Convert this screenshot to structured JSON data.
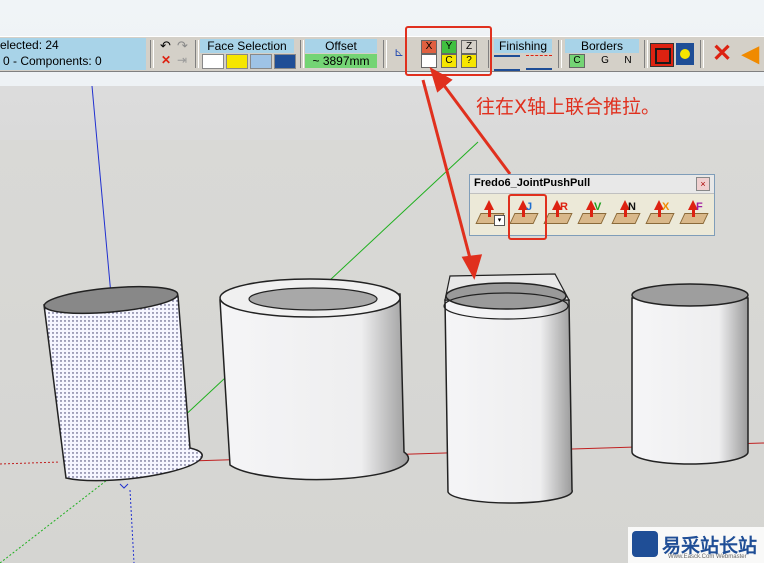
{
  "toolbar": {
    "selected": "elected: 24",
    "components": "0 - Components: 0",
    "face_selection": "Face Selection",
    "offset_label": "Offset",
    "offset_value": "~ 3897mm",
    "axis_x": "X",
    "axis_y": "Y",
    "axis_z": "Z",
    "axis_c": "C",
    "axis_q": "?",
    "finishing": "Finishing",
    "borders": "Borders",
    "border_c": "C",
    "border_g": "G",
    "border_n": "N"
  },
  "annotation": "往在X轴上联合推拉。",
  "panel": {
    "title": "Fredo6_JointPushPull",
    "close": "×",
    "tools": [
      "",
      "J",
      "R",
      "V",
      "N",
      "X",
      "F"
    ]
  },
  "watermark": {
    "main": "易采站长站",
    "sub": "Www.Easck.Com Webmaster"
  },
  "colors": {
    "annotation": "#e0301e",
    "accent_blue": "#a8d3e8"
  }
}
